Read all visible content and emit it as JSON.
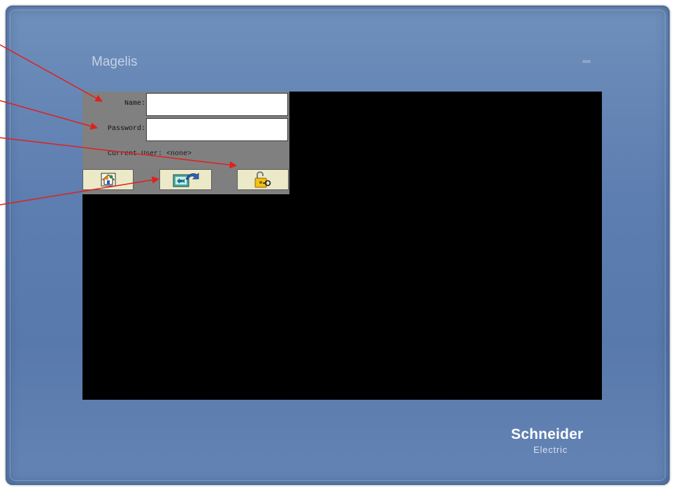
{
  "device": {
    "brand_label": "Magelis",
    "maker_logo": {
      "top": "Schneider",
      "bottom": "Electric"
    },
    "bezel_color": "#5d7eb0",
    "screen_color": "#000000"
  },
  "login": {
    "name_label": "Name:",
    "name_value": "",
    "password_label": "Password:",
    "password_value": "",
    "current_user_text": "Current User: <none>",
    "panel_color": "#808080"
  },
  "buttons": [
    {
      "id": "home",
      "icon": "home-icon"
    },
    {
      "id": "transfer",
      "icon": "screen-transfer-icon"
    },
    {
      "id": "unlock",
      "icon": "padlock-key-icon"
    }
  ],
  "annotation_arrows": {
    "count": 4,
    "color": "#e0201f"
  }
}
